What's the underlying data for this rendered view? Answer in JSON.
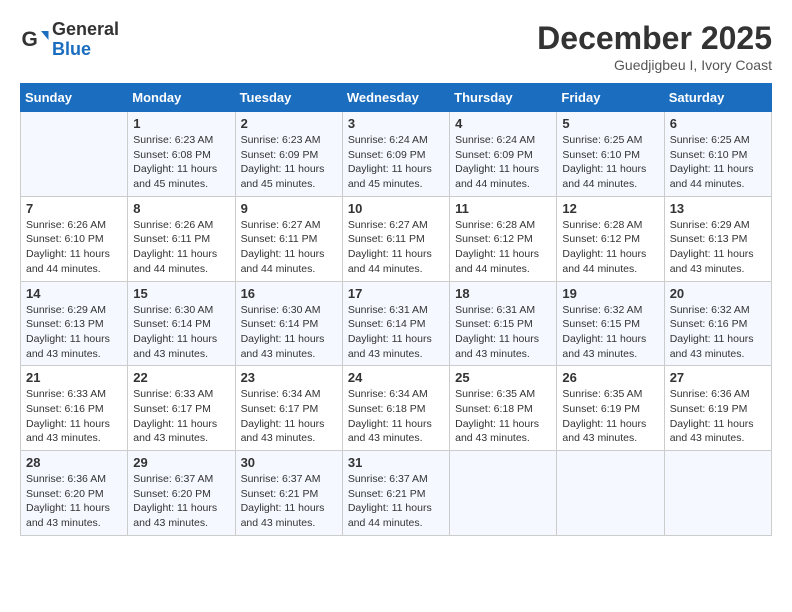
{
  "header": {
    "logo_general": "General",
    "logo_blue": "Blue",
    "month_title": "December 2025",
    "location": "Guedjigbeu I, Ivory Coast"
  },
  "days_of_week": [
    "Sunday",
    "Monday",
    "Tuesday",
    "Wednesday",
    "Thursday",
    "Friday",
    "Saturday"
  ],
  "weeks": [
    [
      {
        "day": "",
        "info": ""
      },
      {
        "day": "1",
        "info": "Sunrise: 6:23 AM\nSunset: 6:08 PM\nDaylight: 11 hours and 45 minutes."
      },
      {
        "day": "2",
        "info": "Sunrise: 6:23 AM\nSunset: 6:09 PM\nDaylight: 11 hours and 45 minutes."
      },
      {
        "day": "3",
        "info": "Sunrise: 6:24 AM\nSunset: 6:09 PM\nDaylight: 11 hours and 45 minutes."
      },
      {
        "day": "4",
        "info": "Sunrise: 6:24 AM\nSunset: 6:09 PM\nDaylight: 11 hours and 44 minutes."
      },
      {
        "day": "5",
        "info": "Sunrise: 6:25 AM\nSunset: 6:10 PM\nDaylight: 11 hours and 44 minutes."
      },
      {
        "day": "6",
        "info": "Sunrise: 6:25 AM\nSunset: 6:10 PM\nDaylight: 11 hours and 44 minutes."
      }
    ],
    [
      {
        "day": "7",
        "info": "Sunrise: 6:26 AM\nSunset: 6:10 PM\nDaylight: 11 hours and 44 minutes."
      },
      {
        "day": "8",
        "info": "Sunrise: 6:26 AM\nSunset: 6:11 PM\nDaylight: 11 hours and 44 minutes."
      },
      {
        "day": "9",
        "info": "Sunrise: 6:27 AM\nSunset: 6:11 PM\nDaylight: 11 hours and 44 minutes."
      },
      {
        "day": "10",
        "info": "Sunrise: 6:27 AM\nSunset: 6:11 PM\nDaylight: 11 hours and 44 minutes."
      },
      {
        "day": "11",
        "info": "Sunrise: 6:28 AM\nSunset: 6:12 PM\nDaylight: 11 hours and 44 minutes."
      },
      {
        "day": "12",
        "info": "Sunrise: 6:28 AM\nSunset: 6:12 PM\nDaylight: 11 hours and 44 minutes."
      },
      {
        "day": "13",
        "info": "Sunrise: 6:29 AM\nSunset: 6:13 PM\nDaylight: 11 hours and 43 minutes."
      }
    ],
    [
      {
        "day": "14",
        "info": "Sunrise: 6:29 AM\nSunset: 6:13 PM\nDaylight: 11 hours and 43 minutes."
      },
      {
        "day": "15",
        "info": "Sunrise: 6:30 AM\nSunset: 6:14 PM\nDaylight: 11 hours and 43 minutes."
      },
      {
        "day": "16",
        "info": "Sunrise: 6:30 AM\nSunset: 6:14 PM\nDaylight: 11 hours and 43 minutes."
      },
      {
        "day": "17",
        "info": "Sunrise: 6:31 AM\nSunset: 6:14 PM\nDaylight: 11 hours and 43 minutes."
      },
      {
        "day": "18",
        "info": "Sunrise: 6:31 AM\nSunset: 6:15 PM\nDaylight: 11 hours and 43 minutes."
      },
      {
        "day": "19",
        "info": "Sunrise: 6:32 AM\nSunset: 6:15 PM\nDaylight: 11 hours and 43 minutes."
      },
      {
        "day": "20",
        "info": "Sunrise: 6:32 AM\nSunset: 6:16 PM\nDaylight: 11 hours and 43 minutes."
      }
    ],
    [
      {
        "day": "21",
        "info": "Sunrise: 6:33 AM\nSunset: 6:16 PM\nDaylight: 11 hours and 43 minutes."
      },
      {
        "day": "22",
        "info": "Sunrise: 6:33 AM\nSunset: 6:17 PM\nDaylight: 11 hours and 43 minutes."
      },
      {
        "day": "23",
        "info": "Sunrise: 6:34 AM\nSunset: 6:17 PM\nDaylight: 11 hours and 43 minutes."
      },
      {
        "day": "24",
        "info": "Sunrise: 6:34 AM\nSunset: 6:18 PM\nDaylight: 11 hours and 43 minutes."
      },
      {
        "day": "25",
        "info": "Sunrise: 6:35 AM\nSunset: 6:18 PM\nDaylight: 11 hours and 43 minutes."
      },
      {
        "day": "26",
        "info": "Sunrise: 6:35 AM\nSunset: 6:19 PM\nDaylight: 11 hours and 43 minutes."
      },
      {
        "day": "27",
        "info": "Sunrise: 6:36 AM\nSunset: 6:19 PM\nDaylight: 11 hours and 43 minutes."
      }
    ],
    [
      {
        "day": "28",
        "info": "Sunrise: 6:36 AM\nSunset: 6:20 PM\nDaylight: 11 hours and 43 minutes."
      },
      {
        "day": "29",
        "info": "Sunrise: 6:37 AM\nSunset: 6:20 PM\nDaylight: 11 hours and 43 minutes."
      },
      {
        "day": "30",
        "info": "Sunrise: 6:37 AM\nSunset: 6:21 PM\nDaylight: 11 hours and 43 minutes."
      },
      {
        "day": "31",
        "info": "Sunrise: 6:37 AM\nSunset: 6:21 PM\nDaylight: 11 hours and 44 minutes."
      },
      {
        "day": "",
        "info": ""
      },
      {
        "day": "",
        "info": ""
      },
      {
        "day": "",
        "info": ""
      }
    ]
  ]
}
